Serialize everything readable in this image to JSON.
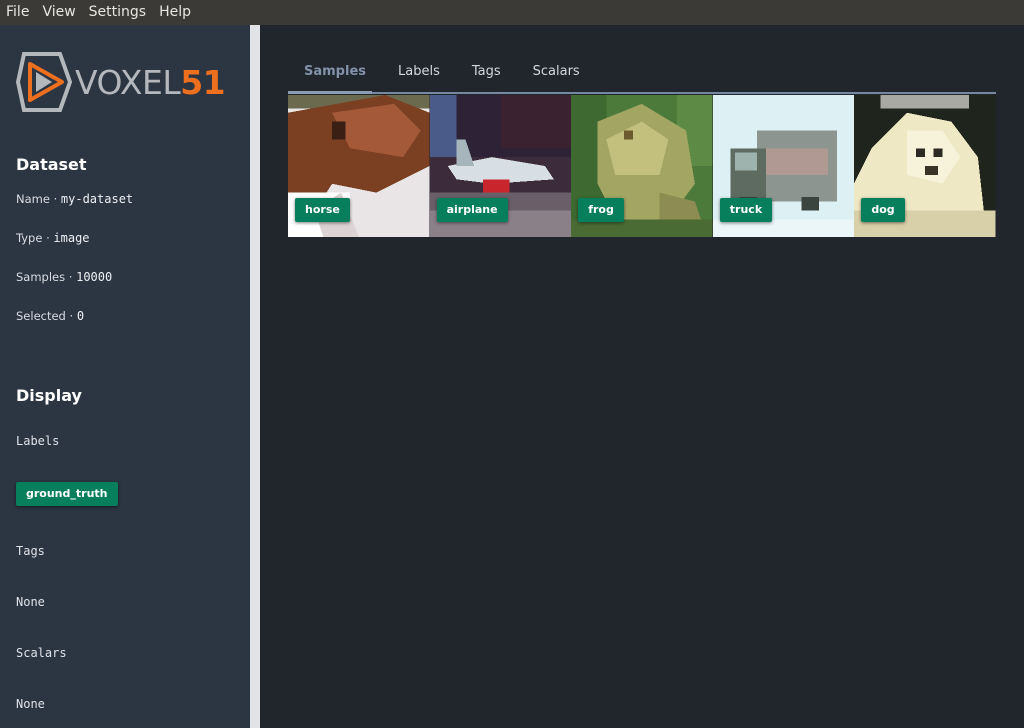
{
  "menubar": {
    "items": [
      "File",
      "View",
      "Settings",
      "Help"
    ]
  },
  "logo": {
    "word": "VOXEL",
    "number": "51"
  },
  "dataset": {
    "title": "Dataset",
    "name_label": "Name",
    "name_value": "my-dataset",
    "type_label": "Type",
    "type_value": "image",
    "samples_label": "Samples",
    "samples_value": "10000",
    "selected_label": "Selected",
    "selected_value": "0"
  },
  "display": {
    "title": "Display",
    "labels_heading": "Labels",
    "labels_chip": "ground_truth",
    "tags_heading": "Tags",
    "tags_value": "None",
    "scalars_heading": "Scalars",
    "scalars_value": "None"
  },
  "tabs": [
    "Samples",
    "Labels",
    "Tags",
    "Scalars"
  ],
  "active_tab": "Samples",
  "samples": [
    {
      "label": "horse"
    },
    {
      "label": "airplane"
    },
    {
      "label": "frog"
    },
    {
      "label": "truck"
    },
    {
      "label": "dog"
    }
  ],
  "colors": {
    "accent": "#077e5c",
    "brand_orange": "#ee6f1e",
    "sidebar": "#2c3542",
    "background": "#21252c"
  }
}
